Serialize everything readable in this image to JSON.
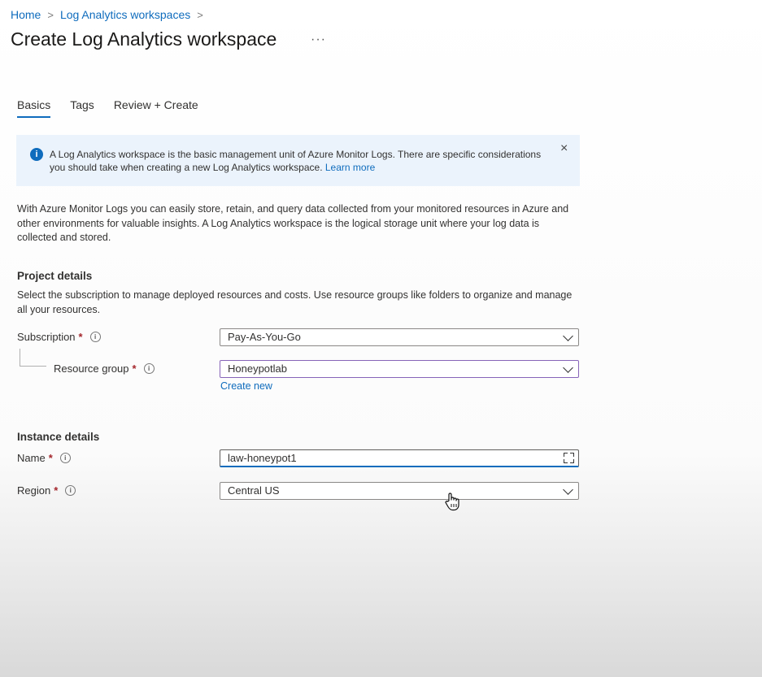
{
  "breadcrumb": {
    "items": [
      "Home",
      "Log Analytics workspaces"
    ],
    "separator": ">"
  },
  "header": {
    "title": "Create Log Analytics workspace",
    "more_label": "···"
  },
  "tabs": [
    {
      "label": "Basics",
      "active": true
    },
    {
      "label": "Tags",
      "active": false
    },
    {
      "label": "Review + Create",
      "active": false
    }
  ],
  "info_banner": {
    "text": "A Log Analytics workspace is the basic management unit of Azure Monitor Logs. There are specific considerations you should take when creating a new Log Analytics workspace.",
    "link": "Learn more",
    "icon": "info-icon",
    "close_label": "×"
  },
  "intro_text": "With Azure Monitor Logs you can easily store, retain, and query data collected from your monitored resources in Azure and other environments for valuable insights. A Log Analytics workspace is the logical storage unit where your log data is collected and stored.",
  "project_details": {
    "heading": "Project details",
    "description": "Select the subscription to manage deployed resources and costs. Use resource groups like folders to organize and manage all your resources.",
    "subscription": {
      "label": "Subscription",
      "value": "Pay-As-You-Go"
    },
    "resource_group": {
      "label": "Resource group",
      "value": "Honeypotlab",
      "create_new": "Create new"
    }
  },
  "instance_details": {
    "heading": "Instance details",
    "name": {
      "label": "Name",
      "value": "law-honeypot1"
    },
    "region": {
      "label": "Region",
      "value": "Central US"
    }
  },
  "required_marker": "*",
  "info_marker": "i",
  "colors": {
    "accent": "#0f6cbd",
    "banner_bg": "#ebf3fc",
    "required": "#a4262c",
    "focused_border": "#8764b8"
  }
}
